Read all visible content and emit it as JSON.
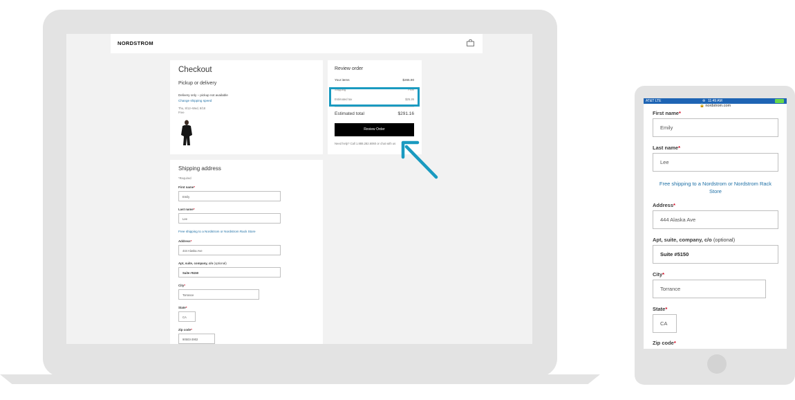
{
  "laptop": {
    "brand": "NORDSTROM",
    "checkout": {
      "title": "Checkout",
      "subtitle": "Pickup or delivery",
      "delivery_note": "Delivery only – pickup not available",
      "change_speed": "Change shipping speed",
      "dates": "Thu, 8/12–Wed, 8/18",
      "cost": "Free"
    },
    "review": {
      "title": "Review order",
      "rows": [
        {
          "label": "Your items",
          "value": "$265.90"
        },
        {
          "label": "Shipping",
          "value": "Free"
        },
        {
          "label": "Estimated tax",
          "value": "$25.26"
        }
      ],
      "total_label": "Estimated total",
      "total_value": "$291.16",
      "button": "Review Order",
      "help": "Need help? Call 1.888.282.6060 or chat with us"
    },
    "address": {
      "title": "Shipping address",
      "required_note": "*Required",
      "first_name_label": "First name",
      "first_name_value": "Emily",
      "last_name_label": "Last name",
      "last_name_value": "Lee",
      "store_link": "Free shipping to a Nordstrom or Nordstrom Rack Store",
      "address_label": "Address",
      "address_value": "444 Alaska Ave",
      "apt_label": "Apt, suite, company, c/o",
      "optional": "(optional)",
      "apt_value": "Suite #5150",
      "city_label": "City",
      "city_value": "Torrance",
      "state_label": "State",
      "state_value": "CA",
      "zip_label": "Zip code",
      "zip_value": "90503-3902"
    }
  },
  "phone": {
    "carrier": "AT&T  LTE",
    "time": "11:49 AM",
    "url": "nordstrom.com",
    "first_name_label": "First name",
    "first_name_value": "Emily",
    "last_name_label": "Last name",
    "last_name_value": "Lee",
    "store_link": "Free shipping to a Nordstrom or Nordstrom Rack Store",
    "address_label": "Address",
    "address_value": "444 Alaska Ave",
    "apt_label": "Apt, suite, company, c/o",
    "optional": "(optional)",
    "apt_value": "Suite #5150",
    "city_label": "City",
    "city_value": "Torrance",
    "state_label": "State",
    "state_value": "CA",
    "zip_label": "Zip code",
    "required_mark": "*"
  },
  "colors": {
    "accent": "#1a9ac0",
    "link": "#1d6fa5",
    "required": "#d0021b",
    "status_bar": "#1e64b4"
  },
  "icons": [
    "shopping-bag-icon",
    "arrow-icon",
    "lock-icon",
    "wifi-icon",
    "battery-icon"
  ]
}
